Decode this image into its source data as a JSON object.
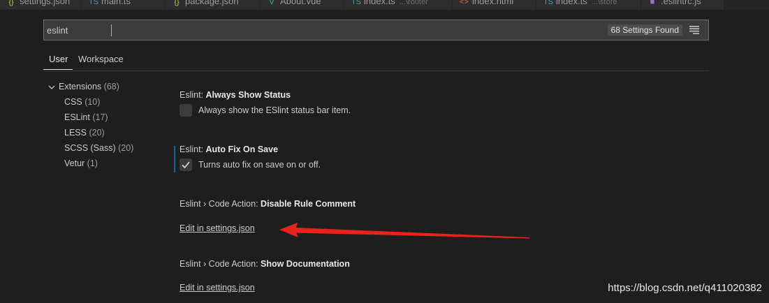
{
  "tabs": [
    {
      "label": "settings.json",
      "icon": "braces-icon",
      "hint": ""
    },
    {
      "label": "main.ts",
      "icon": "ts-icon",
      "hint": ""
    },
    {
      "label": "package.json",
      "icon": "braces-icon",
      "hint": ""
    },
    {
      "label": "About.vue",
      "icon": "vue-icon",
      "hint": ""
    },
    {
      "label": "index.ts",
      "icon": "ts-icon",
      "hint": "...\\router"
    },
    {
      "label": "index.html",
      "icon": "html-icon",
      "hint": ""
    },
    {
      "label": "index.ts",
      "icon": "ts-icon",
      "hint": "...\\store"
    },
    {
      "label": ".eslintrc.js",
      "icon": "js-icon",
      "hint": ""
    }
  ],
  "search": {
    "value": "eslint",
    "results_badge": "68 Settings Found"
  },
  "scope_tabs": [
    {
      "label": "User",
      "active": true
    },
    {
      "label": "Workspace",
      "active": false
    }
  ],
  "toc": {
    "group": {
      "label": "Extensions",
      "count": "(68)"
    },
    "items": [
      {
        "label": "CSS",
        "count": "(10)"
      },
      {
        "label": "ESLint",
        "count": "(17)"
      },
      {
        "label": "LESS",
        "count": "(20)"
      },
      {
        "label": "SCSS (Sass)",
        "count": "(20)"
      },
      {
        "label": "Vetur",
        "count": "(1)"
      }
    ]
  },
  "settings": [
    {
      "category": "Eslint:",
      "label": "Always Show Status",
      "description": "Always show the ESlint status bar item.",
      "checked": false
    },
    {
      "category": "Eslint:",
      "label": "Auto Fix On Save",
      "description": "Turns auto fix on save on or off.",
      "checked": true
    },
    {
      "category": "Eslint › Code Action:",
      "label": "Disable Rule Comment",
      "link": "Edit in settings.json"
    },
    {
      "category": "Eslint › Code Action:",
      "label": "Show Documentation",
      "link": "Edit in settings.json"
    }
  ],
  "annotation_color": "#e8231b",
  "accent_color": "#0e639c",
  "watermark": "https://blog.csdn.net/q411020382"
}
